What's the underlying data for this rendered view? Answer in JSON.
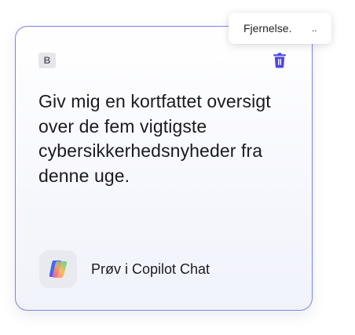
{
  "card": {
    "badge": "B",
    "prompt": "Giv mig en kortfattet oversigt over de fem vigtigste cybersikkerhedsnyheder fra denne uge.",
    "action_label": "Prøv i Copilot Chat",
    "delete_icon": "trash-icon",
    "copilot_icon": "copilot-logo-icon"
  },
  "tooltip": {
    "text": "Fjernelse.",
    "trail": ".."
  },
  "colors": {
    "accent": "#4f46e5",
    "card_border": "#7b84e6"
  }
}
